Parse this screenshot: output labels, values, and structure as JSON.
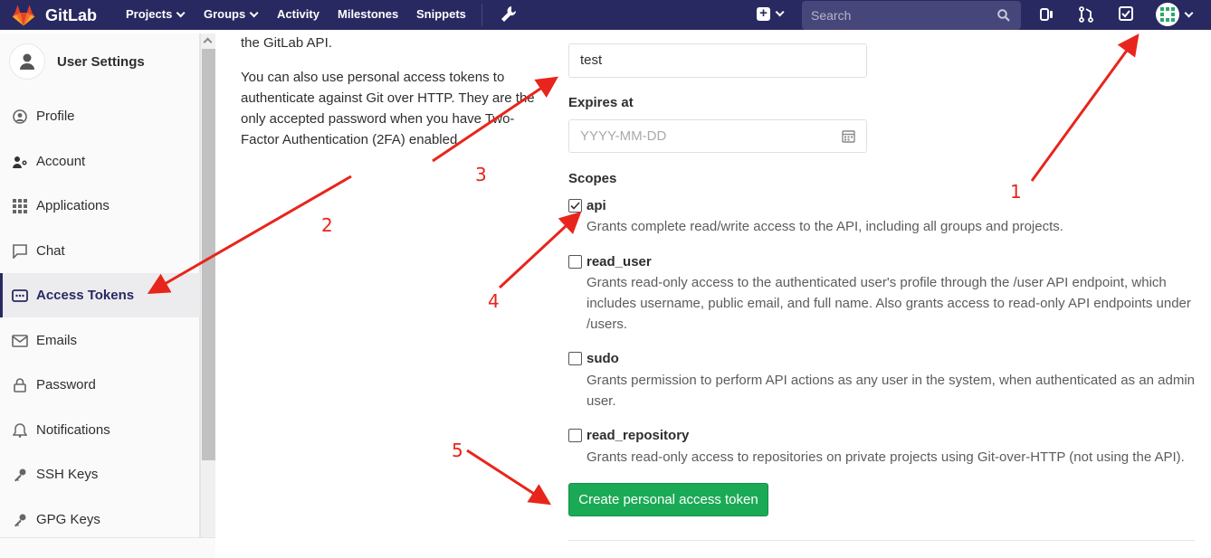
{
  "navbar": {
    "brand": "GitLab",
    "items": [
      "Projects",
      "Groups",
      "Activity",
      "Milestones",
      "Snippets"
    ],
    "search_placeholder": "Search"
  },
  "sidebar": {
    "title": "User Settings",
    "items": [
      {
        "label": "Profile",
        "icon": "profile-icon"
      },
      {
        "label": "Account",
        "icon": "account-icon"
      },
      {
        "label": "Applications",
        "icon": "applications-icon"
      },
      {
        "label": "Chat",
        "icon": "chat-icon"
      },
      {
        "label": "Access Tokens",
        "icon": "access-tokens-icon",
        "active": true
      },
      {
        "label": "Emails",
        "icon": "envelope-icon"
      },
      {
        "label": "Password",
        "icon": "lock-icon"
      },
      {
        "label": "Notifications",
        "icon": "bell-icon"
      },
      {
        "label": "SSH Keys",
        "icon": "key-icon"
      },
      {
        "label": "GPG Keys",
        "icon": "key-icon"
      }
    ]
  },
  "description": {
    "line_top": "the GitLab API.",
    "paragraph": "You can also use personal access tokens to authenticate against Git over HTTP. They are the only accepted password when you have Two-Factor Authentication (2FA) enabled."
  },
  "form": {
    "name_value": "test",
    "expires_label": "Expires at",
    "expires_placeholder": "YYYY-MM-DD",
    "scopes_label": "Scopes",
    "scopes": [
      {
        "name": "api",
        "checked": true,
        "description": "Grants complete read/write access to the API, including all groups and projects."
      },
      {
        "name": "read_user",
        "checked": false,
        "description": "Grants read-only access to the authenticated user's profile through the /user API endpoint, which includes username, public email, and full name. Also grants access to read-only API endpoints under /users."
      },
      {
        "name": "sudo",
        "checked": false,
        "description": "Grants permission to perform API actions as any user in the system, when authenticated as an admin user."
      },
      {
        "name": "read_repository",
        "checked": false,
        "description": "Grants read-only access to repositories on private projects using Git-over-HTTP (not using the API)."
      }
    ],
    "submit_label": "Create personal access token"
  },
  "annotations": [
    "1",
    "2",
    "3",
    "4",
    "5"
  ],
  "colors": {
    "navbar": "#292961",
    "button": "#1aaa55",
    "annotation": "#e8251c"
  }
}
